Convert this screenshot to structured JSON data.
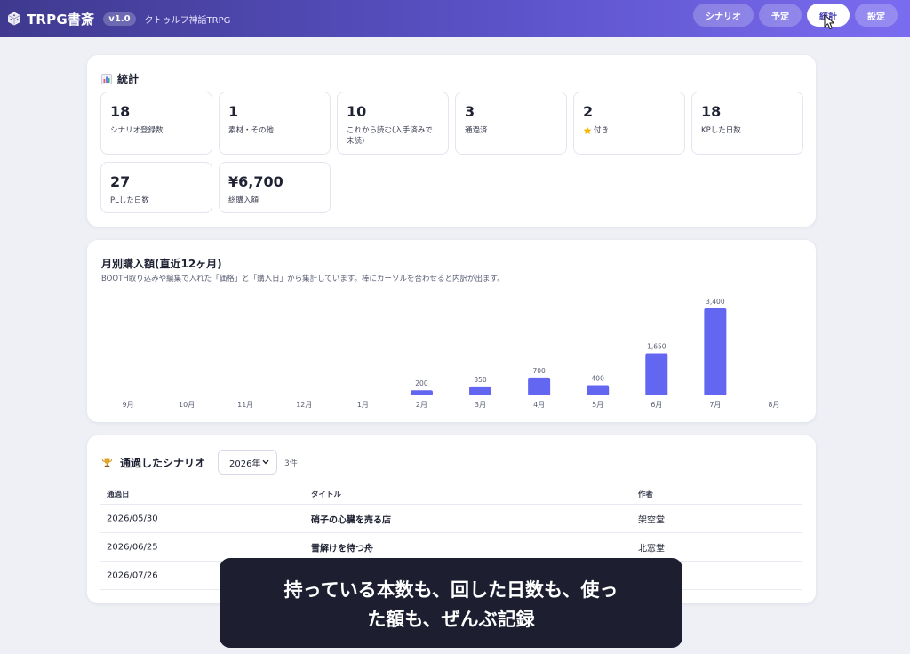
{
  "header": {
    "brand": "TRPG書斎",
    "version": "v1.0",
    "subtitle": "クトゥルフ神話TRPG",
    "nav": [
      {
        "label": "シナリオ",
        "active": false
      },
      {
        "label": "予定",
        "active": false
      },
      {
        "label": "統計",
        "active": true
      },
      {
        "label": "設定",
        "active": false
      }
    ]
  },
  "stats": {
    "title": "統計",
    "tiles": [
      {
        "value": "18",
        "label": "シナリオ登録数"
      },
      {
        "value": "1",
        "label": "素材・その他"
      },
      {
        "value": "10",
        "label": "これから読む(入手済みで未読)"
      },
      {
        "value": "3",
        "label": "通過済"
      },
      {
        "value": "2",
        "label": "付き"
      },
      {
        "value": "18",
        "label": "KPした日数"
      },
      {
        "value": "27",
        "label": "PLした日数"
      },
      {
        "value": "¥6,700",
        "label": "総購入額"
      }
    ]
  },
  "chart": {
    "title": "月別購入額(直近12ヶ月)",
    "description": "BOOTH取り込みや編集で入れた「価格」と「購入日」から集計しています。棒にカーソルを合わせると内訳が出ます。"
  },
  "chart_data": {
    "type": "bar",
    "categories": [
      "9月",
      "10月",
      "11月",
      "12月",
      "1月",
      "2月",
      "3月",
      "4月",
      "5月",
      "6月",
      "7月",
      "8月"
    ],
    "values": [
      0,
      0,
      0,
      0,
      0,
      200,
      350,
      700,
      400,
      1650,
      3400,
      0
    ],
    "data_labels": [
      "",
      "",
      "",
      "",
      "",
      "200",
      "350",
      "700",
      "400",
      "1,650",
      "3,400",
      ""
    ],
    "title": "月別購入額(直近12ヶ月)",
    "ylim": [
      0,
      3400
    ],
    "grid": false,
    "bar_color": "#6366f1"
  },
  "scenarios": {
    "title": "通過したシナリオ",
    "year": "2026年",
    "count": "3件",
    "columns": [
      "通過日",
      "タイトル",
      "作者"
    ],
    "rows": [
      {
        "date": "2026/05/30",
        "title": "硝子の心臓を売る店",
        "author": "架空堂"
      },
      {
        "date": "2026/06/25",
        "title": "雪解けを待つ舟",
        "author": "北窓堂"
      },
      {
        "date": "2026/07/26",
        "title": "",
        "author": ""
      }
    ]
  },
  "overlay": {
    "line1": "持っている本数も、回した日数も、使っ",
    "line2": "た額も、ぜんぶ記録"
  },
  "colors": {
    "accent": "#4a43b6",
    "bar": "#6366f1",
    "star": "#f5b800"
  }
}
